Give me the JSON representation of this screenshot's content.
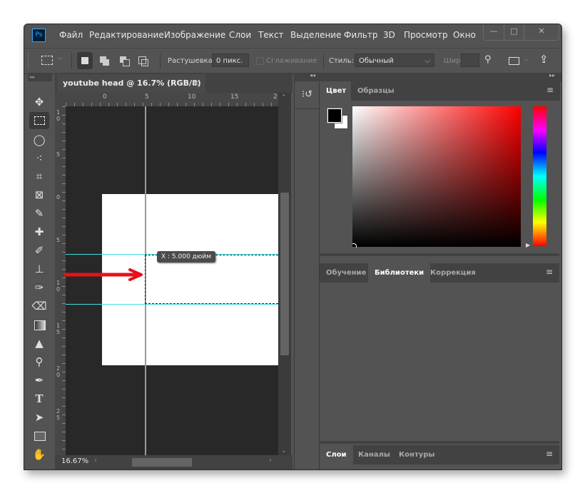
{
  "app": {
    "logo": "Ps"
  },
  "menu": [
    "Файл",
    "Редактирование",
    "Изображение",
    "Слои",
    "Текст",
    "Выделение",
    "Фильтр",
    "3D",
    "Просмотр",
    "Окно"
  ],
  "window_controls": {
    "minimize": "—",
    "maximize": "□",
    "close": "✕"
  },
  "options": {
    "feather_label": "Растушевка:",
    "feather_value": "0 пикс.",
    "antialias_label": "Сглаживание",
    "style_label": "Стиль:",
    "style_value": "Обычный",
    "width_label": "Шир.:"
  },
  "document": {
    "tab_title": "youtube head @ 16.7% (RGB/8) *",
    "close_glyph": "×",
    "zoom": "16.67%",
    "ruler_h_labels": [
      "0",
      "5",
      "10",
      "15",
      "2"
    ],
    "ruler_v_labels": [
      "1 0",
      "5",
      "0",
      "5",
      "1 0",
      "1 5",
      "2 0",
      "2 5"
    ],
    "tooltip": "X :  5.000 дюйм"
  },
  "panels": {
    "top_tabs": [
      "Цвет",
      "Образцы"
    ],
    "mid_tabs": [
      "Обучение",
      "Библиотеки",
      "Коррекция"
    ],
    "bottom_tabs": [
      "Слои",
      "Каналы",
      "Контуры"
    ],
    "foreground_color": "#000000",
    "background_color": "#ffffff",
    "hue_color": "#ff0000"
  }
}
